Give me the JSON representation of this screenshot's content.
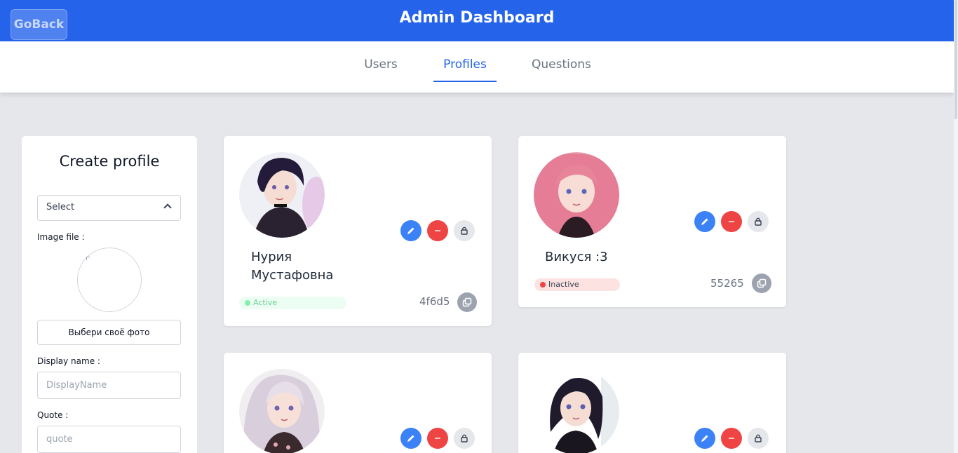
{
  "header": {
    "goback_label": "GoBack",
    "title": "Admin Dashboard"
  },
  "tabs": [
    {
      "label": "Users"
    },
    {
      "label": "Profiles",
      "active": true
    },
    {
      "label": "Questions"
    }
  ],
  "create": {
    "title": "Create profile",
    "select_value": "Select",
    "image_label": "Image file :",
    "file_button": "Выбери своё фото",
    "display_label": "Display name :",
    "display_placeholder": "DisplayName",
    "quote_label": "Quote :",
    "quote_placeholder": "quote"
  },
  "profiles": [
    {
      "name": "Нурия Мустафовна",
      "status": "Active",
      "id": "4f6d5"
    },
    {
      "name": "Викуся :3",
      "status": "Inactive",
      "id": "55265"
    },
    {
      "name": "",
      "status": "",
      "id": ""
    },
    {
      "name": "",
      "status": "",
      "id": ""
    }
  ],
  "colors": {
    "primary": "#2563eb",
    "delete": "#ef4444",
    "edit": "#3b82f6",
    "page_bg": "#e5e7eb"
  },
  "icons": {
    "edit": "pencil-icon",
    "delete": "minus-icon",
    "lock": "lock-icon",
    "copy": "copy-icon"
  }
}
